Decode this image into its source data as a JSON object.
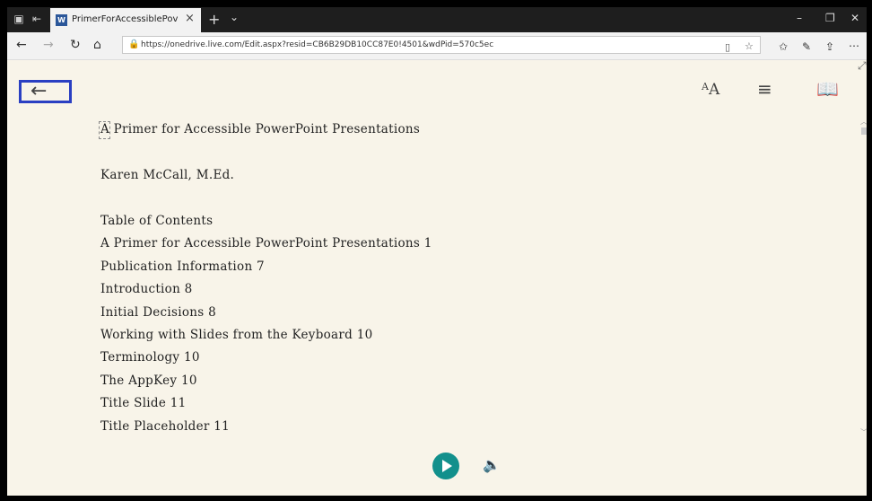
{
  "browser": {
    "tab_title": "PrimerForAccessiblePov",
    "url": "https://onedrive.live.com/Edit.aspx?resid=CB6B29DB10CC87E0!4501&wdPid=570c5ec"
  },
  "document": {
    "lines": [
      "A Primer for Accessible PowerPoint Presentations",
      "Karen McCall, M.Ed.",
      "Table of Contents",
      "A Primer for Accessible PowerPoint Presentations 1",
      "Publication Information 7",
      "Introduction 8",
      "Initial Decisions 8",
      "Working with Slides from the Keyboard 10",
      "Terminology 10",
      "The AppKey 10",
      "Title Slide 11",
      "Title Placeholder 11"
    ]
  },
  "icons": {
    "text_preferences": "A",
    "text_preferences_sub": "A"
  }
}
